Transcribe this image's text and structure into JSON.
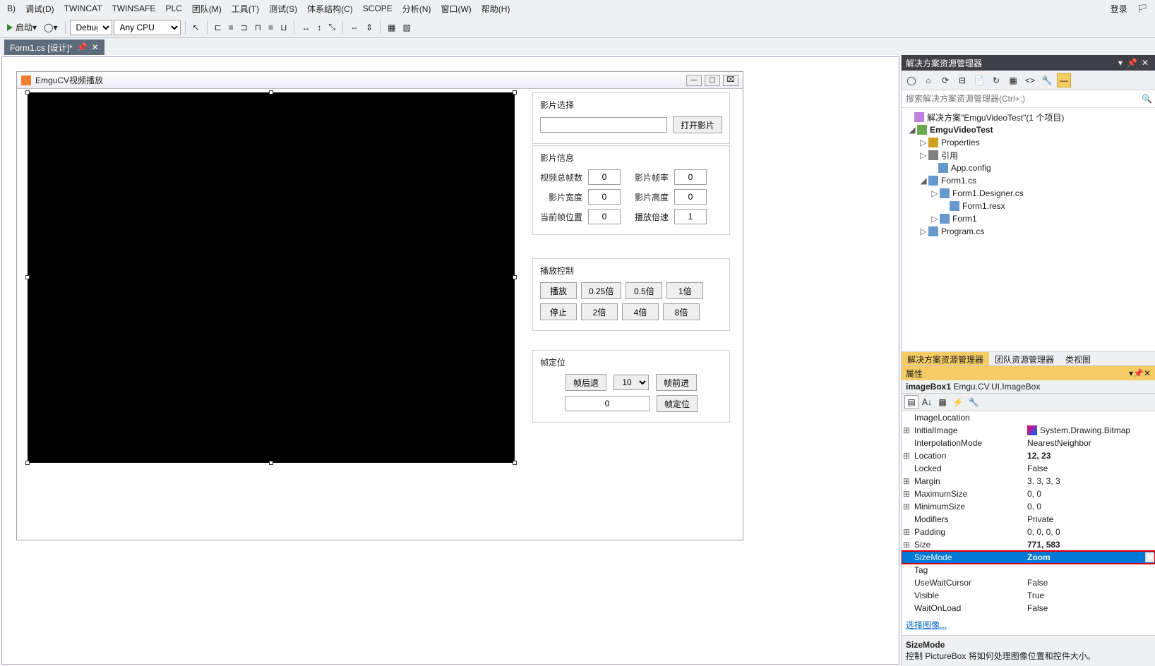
{
  "menubar": {
    "items": [
      {
        "label": "B)"
      },
      {
        "label": "调试(D)"
      },
      {
        "label": "TWINCAT"
      },
      {
        "label": "TWINSAFE"
      },
      {
        "label": "PLC"
      },
      {
        "label": "团队(M)"
      },
      {
        "label": "工具(T)"
      },
      {
        "label": "测试(S)"
      },
      {
        "label": "体系结构(C)"
      },
      {
        "label": "SCOPE"
      },
      {
        "label": "分析(N)"
      },
      {
        "label": "窗口(W)"
      },
      {
        "label": "帮助(H)"
      }
    ],
    "login": "登录"
  },
  "toolbar": {
    "start": "启动",
    "config": "Debug",
    "platform": "Any CPU"
  },
  "doc_tab": {
    "label": "Form1.cs [设计]*"
  },
  "form": {
    "title": "EmguCV视频播放",
    "sel": {
      "title": "影片选择",
      "path": "",
      "open": "打开影片"
    },
    "info": {
      "title": "影片信息",
      "totalFramesL": "视频总帧数",
      "totalFrames": "0",
      "fpsL": "影片帧率",
      "fps": "0",
      "widthL": "影片宽度",
      "width": "0",
      "heightL": "影片高度",
      "height": "0",
      "curFrameL": "当前帧位置",
      "curFrame": "0",
      "speedL": "播放倍速",
      "speed": "1"
    },
    "play": {
      "title": "播放控制",
      "play": "播放",
      "stop": "停止",
      "q": "0.25倍",
      "h": "0.5倍",
      "x1": "1倍",
      "x2": "2倍",
      "x4": "4倍",
      "x8": "8倍"
    },
    "seek": {
      "title": "帧定位",
      "back": "帧后退",
      "step": "10",
      "fwd": "帧前进",
      "pos": "0",
      "go": "帧定位"
    }
  },
  "solution": {
    "title": "解决方案资源管理器",
    "searchPlaceholder": "搜索解决方案资源管理器(Ctrl+;)",
    "root": "解决方案\"EmguVideoTest\"(1 个项目)",
    "project": "EmguVideoTest",
    "nodes": {
      "props": "Properties",
      "refs": "引用",
      "app": "App.config",
      "form": "Form1.cs",
      "desg": "Form1.Designer.cs",
      "resx": "Form1.resx",
      "form1": "Form1",
      "prog": "Program.cs"
    },
    "tabs": [
      "解决方案资源管理器",
      "团队资源管理器",
      "类视图"
    ]
  },
  "props": {
    "title": "属性",
    "obj": "imageBox1",
    "type": "Emgu.CV.UI.ImageBox",
    "rows": [
      {
        "n": "ImageLocation",
        "v": "",
        "e": ""
      },
      {
        "n": "InitialImage",
        "v": "System.Drawing.Bitmap",
        "e": "⊞",
        "bmp": true
      },
      {
        "n": "InterpolationMode",
        "v": "NearestNeighbor",
        "e": ""
      },
      {
        "n": "Location",
        "v": "12, 23",
        "e": "⊞",
        "bold": true
      },
      {
        "n": "Locked",
        "v": "False",
        "e": ""
      },
      {
        "n": "Margin",
        "v": "3, 3, 3, 3",
        "e": "⊞"
      },
      {
        "n": "MaximumSize",
        "v": "0, 0",
        "e": "⊞"
      },
      {
        "n": "MinimumSize",
        "v": "0, 0",
        "e": "⊞"
      },
      {
        "n": "Modifiers",
        "v": "Private",
        "e": ""
      },
      {
        "n": "Padding",
        "v": "0, 0, 0, 0",
        "e": "⊞"
      },
      {
        "n": "Size",
        "v": "771, 583",
        "e": "⊞",
        "bold": true
      },
      {
        "n": "SizeMode",
        "v": "Zoom",
        "e": "",
        "sel": true,
        "bold": true,
        "boxed": true,
        "dd": true
      },
      {
        "n": "Tag",
        "v": "",
        "e": ""
      },
      {
        "n": "UseWaitCursor",
        "v": "False",
        "e": ""
      },
      {
        "n": "Visible",
        "v": "True",
        "e": ""
      },
      {
        "n": "WaitOnLoad",
        "v": "False",
        "e": ""
      }
    ],
    "link": "选择图像...",
    "helpTitle": "SizeMode",
    "helpText": "控制 PictureBox 将如何处理图像位置和控件大小。"
  }
}
